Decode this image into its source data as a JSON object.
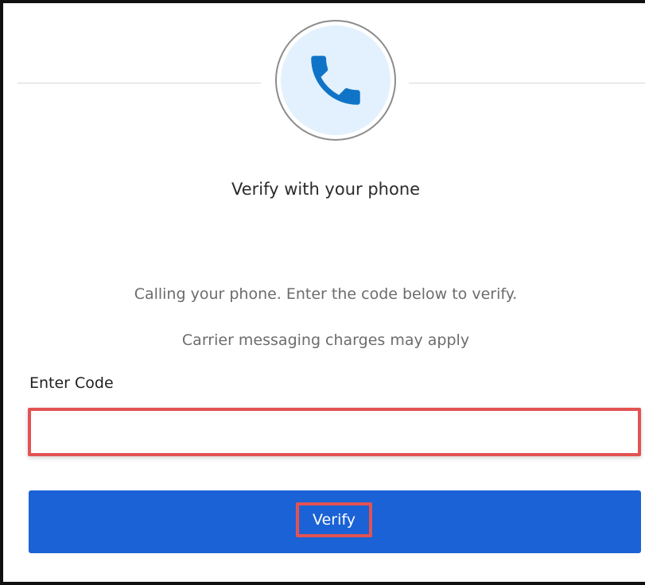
{
  "header": {
    "icon": "phone-icon",
    "icon_color": "#0f74c7",
    "icon_background": "#e2f1fd"
  },
  "title": "Verify with your phone",
  "messages": {
    "calling": "Calling your phone.  Enter the code below to verify.",
    "charges": "Carrier messaging charges may apply"
  },
  "form": {
    "code_label": "Enter Code",
    "code_value": "",
    "verify_label": "Verify"
  },
  "colors": {
    "primary_button": "#1a62d6",
    "highlight_border": "#e35252"
  }
}
